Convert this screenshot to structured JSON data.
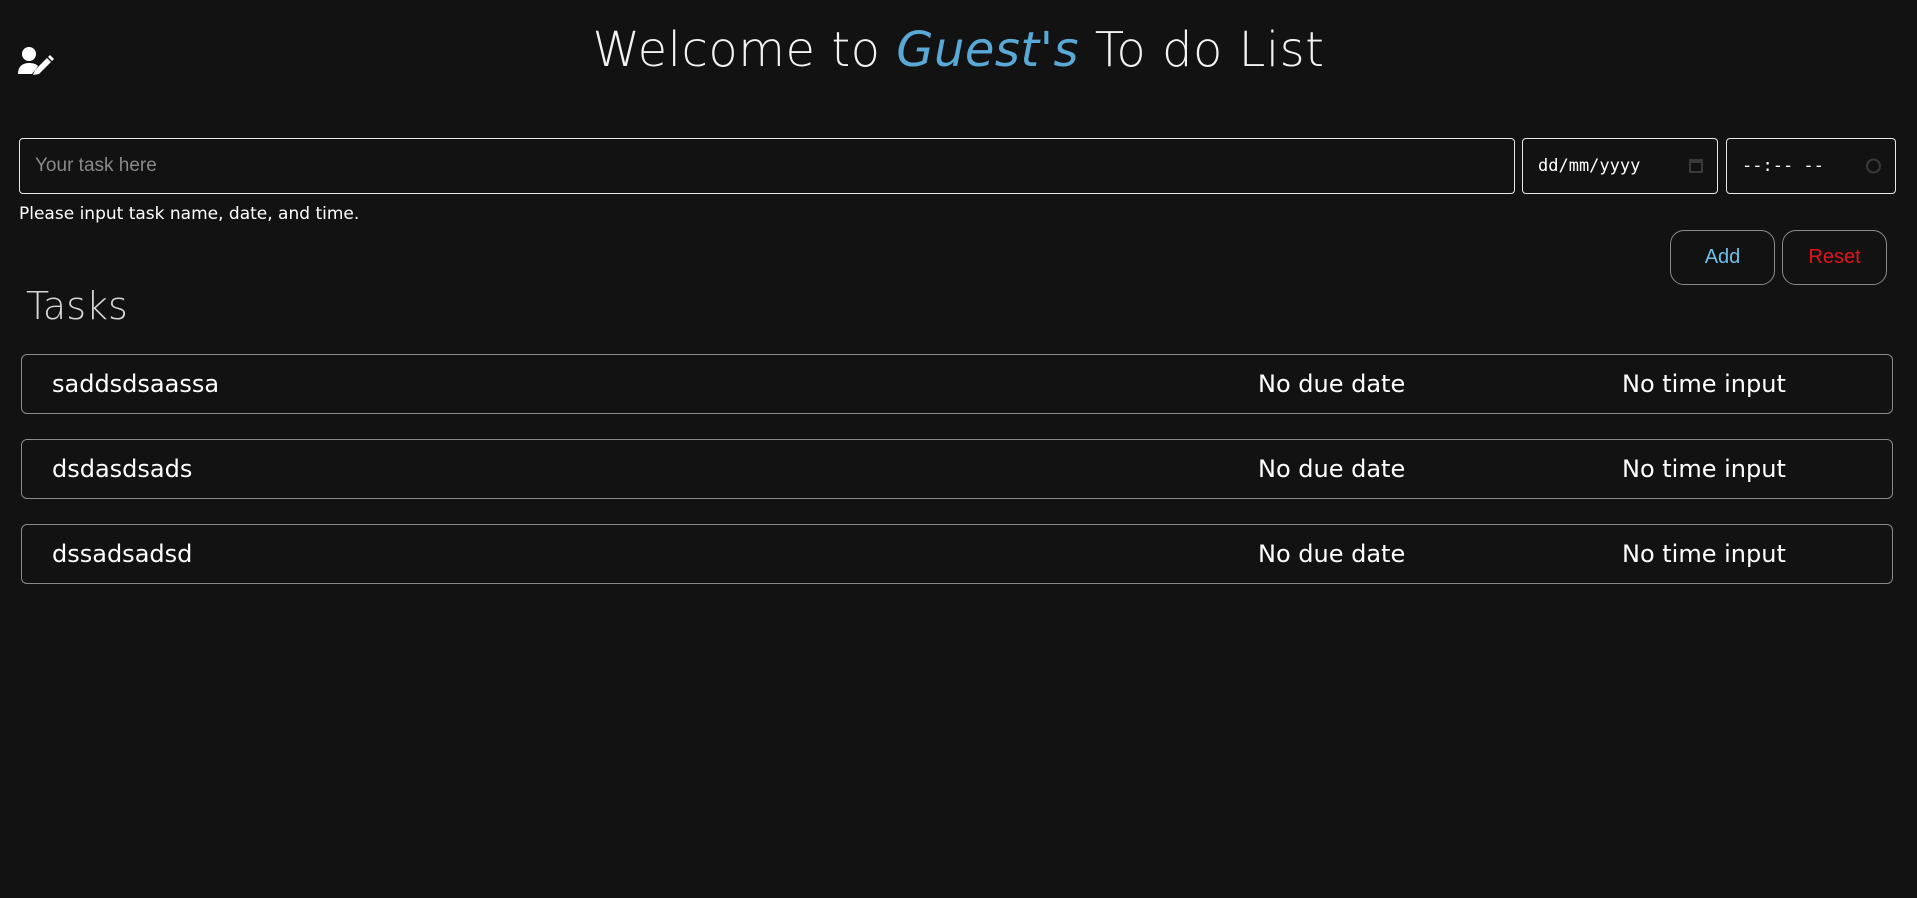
{
  "header": {
    "title_prefix": "Welcome to ",
    "title_user": "Guest's",
    "title_suffix": " To do List",
    "user_icon": "user-edit-icon"
  },
  "form": {
    "task_placeholder": "Your task here",
    "date_placeholder": "dd/mm/yyyy",
    "time_placeholder": "--:-- --",
    "helper_text": "Please input task name, date, and time.",
    "add_label": "Add",
    "reset_label": "Reset"
  },
  "tasks_section": {
    "title": "Tasks",
    "items": [
      {
        "name": "saddsdsaassa",
        "date": "No due date",
        "time": "No time input"
      },
      {
        "name": "dsdasdsads",
        "date": "No due date",
        "time": "No time input"
      },
      {
        "name": "dssadsadsd",
        "date": "No due date",
        "time": "No time input"
      }
    ]
  },
  "colors": {
    "background": "#121212",
    "accent_user": "#5aa8d6",
    "add_button": "#6fc0ea",
    "reset_button": "#e0141a"
  }
}
